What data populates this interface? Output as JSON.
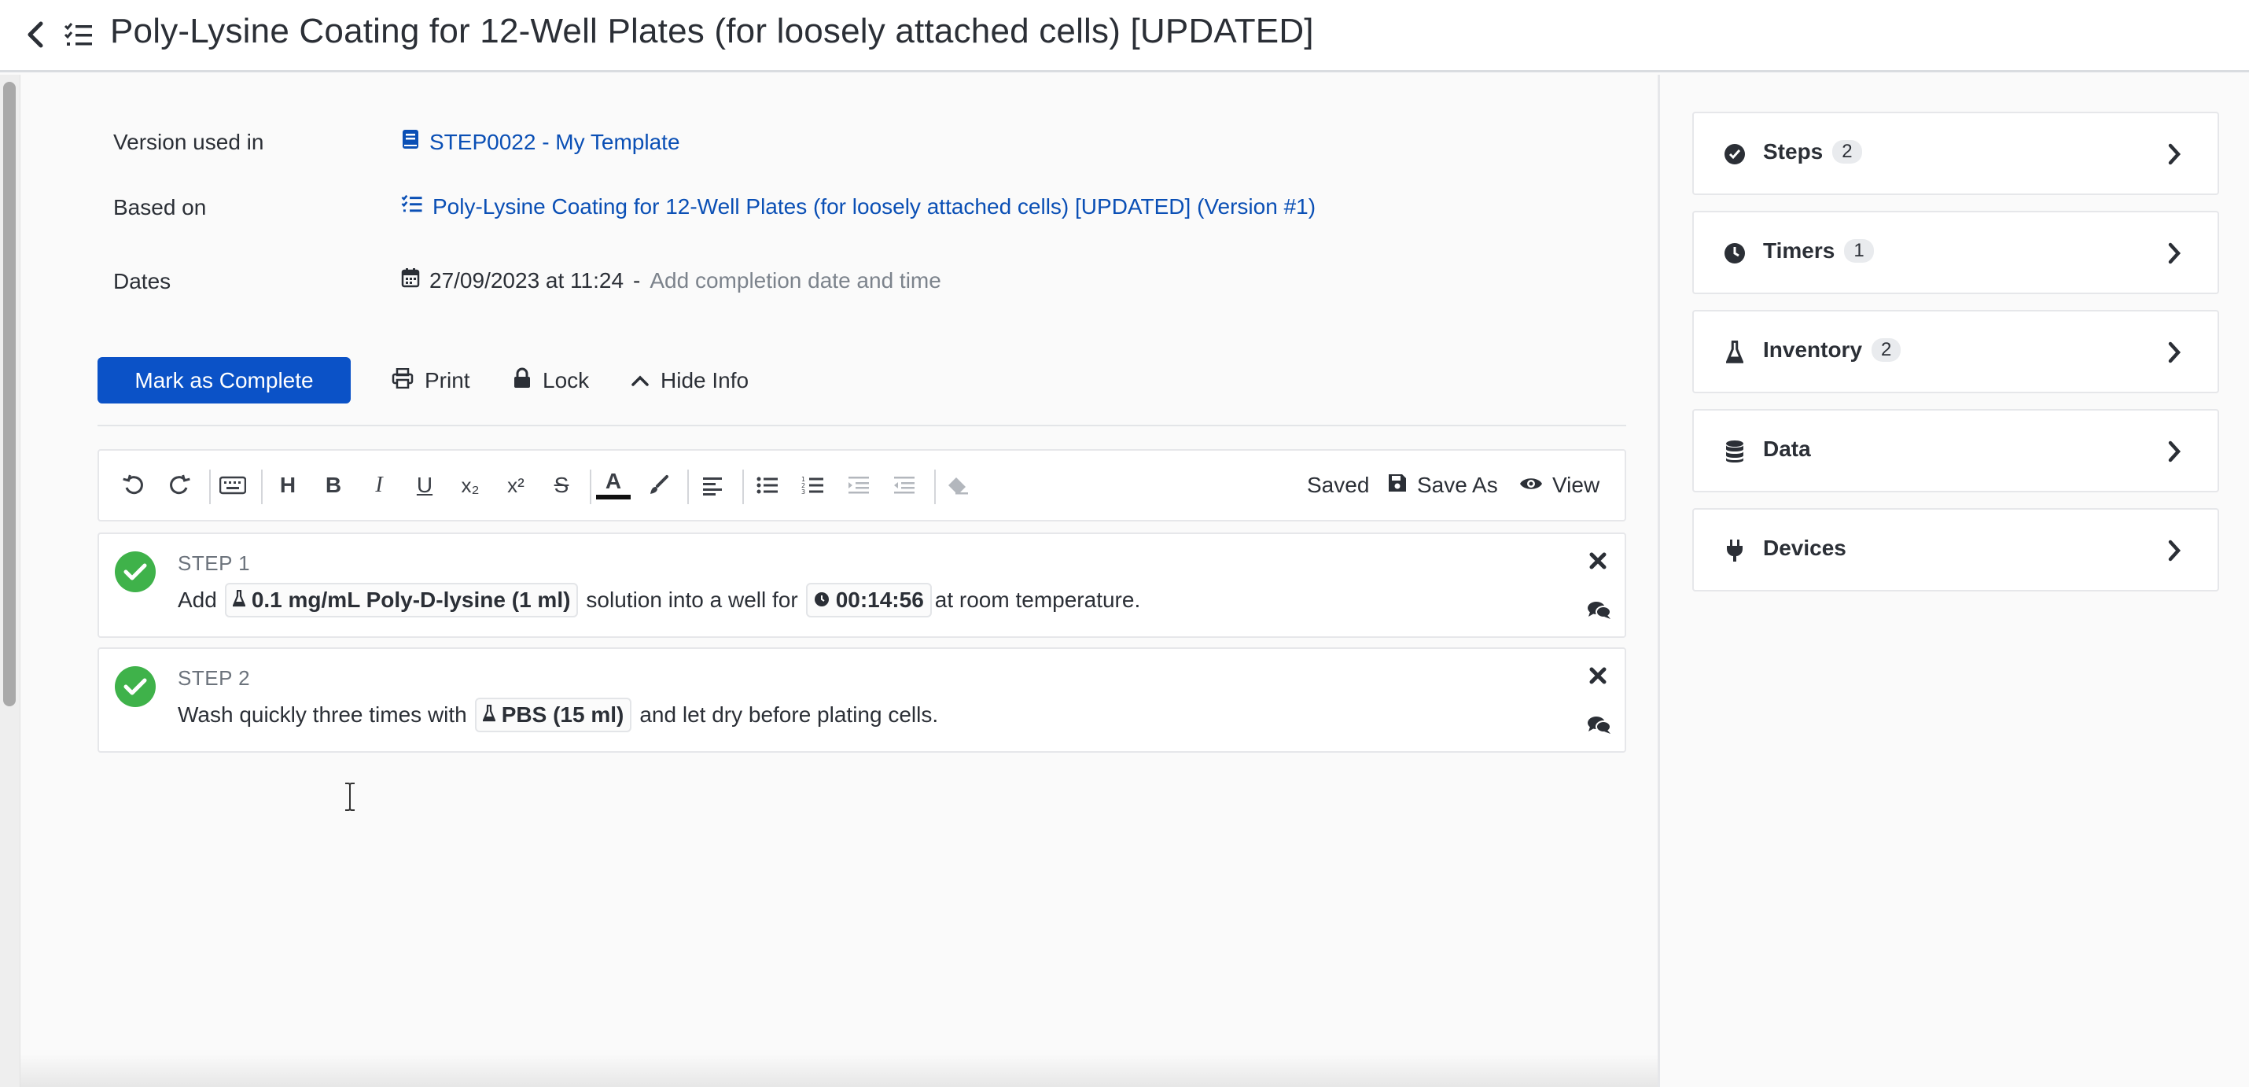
{
  "header": {
    "title": "Poly-Lysine Coating for 12-Well Plates (for loosely attached cells) [UPDATED]"
  },
  "info": {
    "version_label": "Version used in",
    "version_value": "STEP0022 - My Template",
    "based_on_label": "Based on",
    "based_on_value": "Poly-Lysine Coating for 12-Well Plates (for loosely attached cells) [UPDATED] (Version #1)",
    "dates_label": "Dates",
    "start_date": "27/09/2023 at 11:24",
    "dash": "-",
    "completion_placeholder": "Add completion date and time"
  },
  "actions": {
    "mark_complete": "Mark as Complete",
    "print": "Print",
    "lock": "Lock",
    "hide_info": "Hide Info"
  },
  "toolbar": {
    "heading": "H",
    "bold": "B",
    "italic": "I",
    "underline": "U",
    "subscript": "x₂",
    "superscript": "x²",
    "strike": "S",
    "text_color": "A",
    "status": "Saved",
    "save_as": "Save As",
    "view": "View"
  },
  "steps": [
    {
      "label": "STEP 1",
      "text_before": "Add",
      "reagent": "0.1 mg/mL Poly-D-lysine (1 ml)",
      "text_middle": "solution into a well for",
      "timer": "00:14:56",
      "text_after": "at room temperature."
    },
    {
      "label": "STEP 2",
      "text_before": "Wash quickly three times with",
      "reagent": "PBS (15 ml)",
      "text_after": "and let dry before plating cells."
    }
  ],
  "sidebar": {
    "items": [
      {
        "label": "Steps",
        "count": "2",
        "icon": "check-circle-icon"
      },
      {
        "label": "Timers",
        "count": "1",
        "icon": "clock-icon"
      },
      {
        "label": "Inventory",
        "count": "2",
        "icon": "flask-icon"
      },
      {
        "label": "Data",
        "count": "",
        "icon": "database-icon"
      },
      {
        "label": "Devices",
        "count": "",
        "icon": "plug-icon"
      }
    ]
  },
  "colors": {
    "primary": "#0b52c7",
    "link": "#0a4fb5",
    "success": "#3fb24a"
  }
}
